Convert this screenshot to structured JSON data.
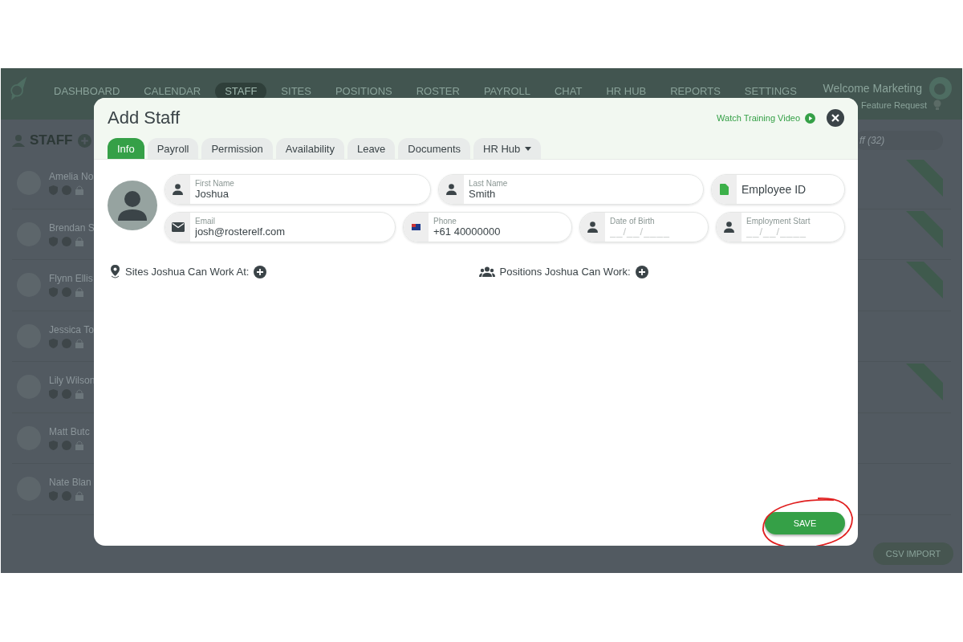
{
  "nav": {
    "items": [
      {
        "label": "DASHBOARD",
        "selected": false
      },
      {
        "label": "CALENDAR",
        "selected": false
      },
      {
        "label": "STAFF",
        "selected": true
      },
      {
        "label": "SITES",
        "selected": false
      },
      {
        "label": "POSITIONS",
        "selected": false
      },
      {
        "label": "ROSTER",
        "selected": false
      },
      {
        "label": "PAYROLL",
        "selected": false
      },
      {
        "label": "CHAT",
        "selected": false
      },
      {
        "label": "HR HUB",
        "selected": false
      },
      {
        "label": "REPORTS",
        "selected": false
      },
      {
        "label": "SETTINGS",
        "selected": false
      }
    ],
    "welcome": "Welcome Marketing",
    "feature_request": "Feature Request"
  },
  "staff_panel": {
    "title": "STAFF",
    "search": "ff (32)",
    "staff": [
      {
        "name": "Amelia No",
        "ribbon": true
      },
      {
        "name": "Brendan S",
        "ribbon": true
      },
      {
        "name": "Flynn Ellis",
        "ribbon": true
      },
      {
        "name": "Jessica To",
        "ribbon": false
      },
      {
        "name": "Lily Wilson",
        "ribbon": true
      },
      {
        "name": "Matt Butc",
        "ribbon": false
      },
      {
        "name": "Nate Blan",
        "ribbon": false
      }
    ],
    "csv_button": "CSV IMPORT"
  },
  "modal": {
    "title": "Add Staff",
    "training_link": "Watch Training Video",
    "tabs": [
      {
        "label": "Info",
        "selected": true,
        "dropdown": false
      },
      {
        "label": "Payroll",
        "selected": false,
        "dropdown": false
      },
      {
        "label": "Permission",
        "selected": false,
        "dropdown": false
      },
      {
        "label": "Availability",
        "selected": false,
        "dropdown": false
      },
      {
        "label": "Leave",
        "selected": false,
        "dropdown": false
      },
      {
        "label": "Documents",
        "selected": false,
        "dropdown": false
      },
      {
        "label": "HR Hub",
        "selected": false,
        "dropdown": true
      }
    ],
    "fields_row1": [
      {
        "kind": "text",
        "label": "First Name",
        "value": "Joshua"
      },
      {
        "kind": "text",
        "label": "Last Name",
        "value": "Smith"
      },
      {
        "kind": "empty",
        "placeholder": "Employee ID"
      }
    ],
    "fields_row2": [
      {
        "kind": "text",
        "label": "Email",
        "value": "josh@rosterelf.com"
      },
      {
        "kind": "text",
        "label": "Phone",
        "value": "+61 40000000"
      },
      {
        "kind": "date",
        "label": "Date of Birth",
        "placeholder": "__/__/____"
      },
      {
        "kind": "date",
        "label": "Employment Start",
        "placeholder": "__/__/____"
      }
    ],
    "sections": [
      {
        "label": "Sites Joshua Can Work At:"
      },
      {
        "label": "Positions Joshua Can Work:"
      }
    ],
    "save": "SAVE"
  }
}
